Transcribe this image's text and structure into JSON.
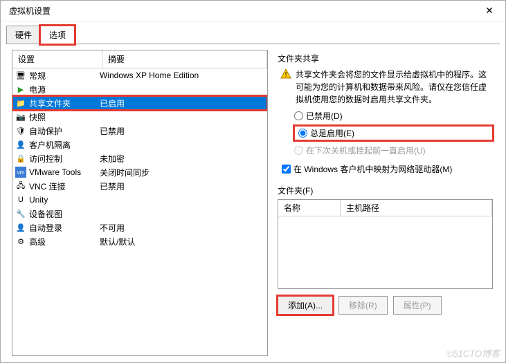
{
  "window": {
    "title": "虚拟机设置"
  },
  "tabs": {
    "hardware": "硬件",
    "options": "选项"
  },
  "list": {
    "header": {
      "setting": "设置",
      "summary": "摘要"
    },
    "rows": [
      {
        "icon": "🖥",
        "name": "常规",
        "summary": "Windows XP Home Edition"
      },
      {
        "icon": "▶",
        "name": "电源",
        "summary": ""
      },
      {
        "icon": "📁",
        "name": "共享文件夹",
        "summary": "已启用",
        "selected": true
      },
      {
        "icon": "📷",
        "name": "快照",
        "summary": ""
      },
      {
        "icon": "🛡",
        "name": "自动保护",
        "summary": "已禁用"
      },
      {
        "icon": "👤",
        "name": "客户机隔离",
        "summary": ""
      },
      {
        "icon": "🔒",
        "name": "访问控制",
        "summary": "未加密"
      },
      {
        "icon": "vm",
        "name": "VMware Tools",
        "summary": "关闭时间同步"
      },
      {
        "icon": "🖧",
        "name": "VNC 连接",
        "summary": "已禁用"
      },
      {
        "icon": "U",
        "name": "Unity",
        "summary": ""
      },
      {
        "icon": "🔧",
        "name": "设备视图",
        "summary": ""
      },
      {
        "icon": "👤",
        "name": "自动登录",
        "summary": "不可用"
      },
      {
        "icon": "⚙",
        "name": "高级",
        "summary": "默认/默认"
      }
    ]
  },
  "share": {
    "title": "文件夹共享",
    "warning": "共享文件夹会将您的文件显示给虚拟机中的程序。这可能为您的计算机和数据带来风险。请仅在您信任虚拟机使用您的数据时启用共享文件夹。",
    "radio_disabled": "已禁用(D)",
    "radio_always": "总是启用(E)",
    "radio_until": "在下次关机或挂起前一直启用(U)",
    "map_drive": "在 Windows 客户机中映射为网络驱动器(M)"
  },
  "folders": {
    "title": "文件夹(F)",
    "col_name": "名称",
    "col_path": "主机路径",
    "btn_add": "添加(A)...",
    "btn_remove": "移除(R)",
    "btn_props": "属性(P)"
  },
  "watermark": "©51CTO博客"
}
